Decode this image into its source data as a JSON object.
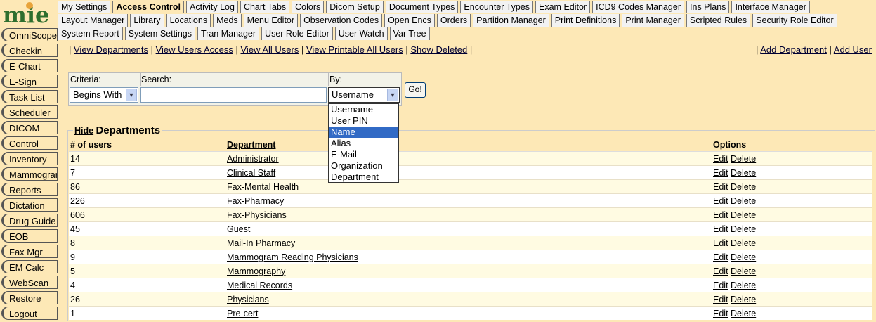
{
  "logo": {
    "text": "mie"
  },
  "topnav": {
    "rows": [
      [
        "My Settings",
        "Access Control",
        "Activity Log",
        "Chart Tabs",
        "Colors",
        "Dicom Setup",
        "Document Types",
        "Encounter Types",
        "Exam Editor",
        "ICD9 Codes Manager",
        "Ins Plans",
        "Interface Manager"
      ],
      [
        "Layout Manager",
        "Library",
        "Locations",
        "Meds",
        "Menu Editor",
        "Observation Codes",
        "Open Encs",
        "Orders",
        "Partition Manager",
        "Print Definitions",
        "Print Manager",
        "Scripted Rules",
        "Security Role Editor"
      ],
      [
        "System Report",
        "System Settings",
        "Tran Manager",
        "User Role Editor",
        "User Watch",
        "Var Tree"
      ]
    ],
    "active": "Access Control"
  },
  "sidebar": {
    "items": [
      "OmniScope",
      "Checkin",
      "E-Chart",
      "E-Sign",
      "Task List",
      "Scheduler",
      "DICOM",
      "Control",
      "Inventory",
      "Mammogram",
      "Reports",
      "Dictation",
      "Drug Guide",
      "EOB",
      "Fax Mgr",
      "EM Calc",
      "WebScan",
      "Restore",
      "Logout"
    ]
  },
  "links_left": [
    "View Departments",
    "View Users Access",
    "View All Users",
    "View Printable All Users",
    "Show Deleted"
  ],
  "links_right": [
    "Add Department",
    "Add User"
  ],
  "search": {
    "criteria_label": "Criteria:",
    "search_label": "Search:",
    "by_label": "By:",
    "criteria_value": "Begins With",
    "search_value": "",
    "by_value": "Username",
    "go_label": "Go!",
    "by_options": [
      "Username",
      "User PIN",
      "Name",
      "Alias",
      "E-Mail",
      "Organization",
      "Department"
    ],
    "highlighted_option": "Name"
  },
  "departments": {
    "hide_label": "Hide",
    "title": "Departments",
    "columns": [
      "# of users",
      "Department",
      "Options"
    ],
    "edit_label": "Edit",
    "delete_label": "Delete",
    "rows": [
      {
        "users": "14",
        "name": "Administrator"
      },
      {
        "users": "7",
        "name": "Clinical Staff"
      },
      {
        "users": "86",
        "name": "Fax-Mental Health"
      },
      {
        "users": "226",
        "name": "Fax-Pharmacy"
      },
      {
        "users": "606",
        "name": "Fax-Physicians"
      },
      {
        "users": "45",
        "name": "Guest"
      },
      {
        "users": "8",
        "name": "Mail-In Pharmacy"
      },
      {
        "users": "9",
        "name": "Mammogram Reading Physicians"
      },
      {
        "users": "5",
        "name": "Mammography"
      },
      {
        "users": "4",
        "name": "Medical Records"
      },
      {
        "users": "26",
        "name": "Physicians"
      },
      {
        "users": "1",
        "name": "Pre-cert"
      }
    ]
  }
}
